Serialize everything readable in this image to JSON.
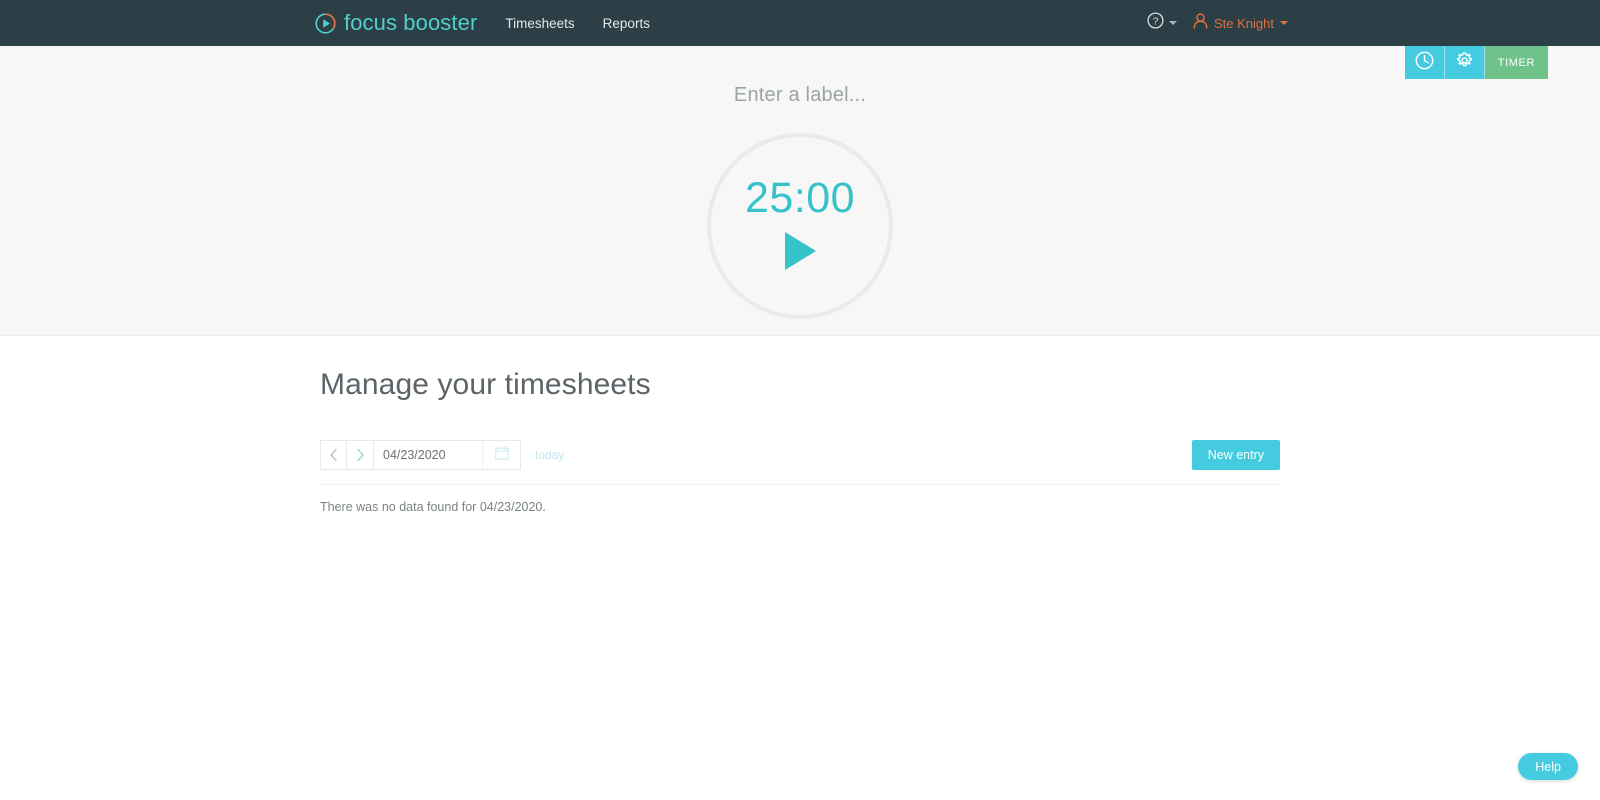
{
  "topbar": {
    "brand": {
      "name": "focus booster",
      "icon": "play-circle-icon"
    },
    "nav": [
      {
        "label": "Timesheets",
        "name": "nav-link-timesheets"
      },
      {
        "label": "Reports",
        "name": "nav-link-reports"
      }
    ],
    "help": {
      "icon": "question-circle-icon"
    },
    "user": {
      "name": "Ste Knight",
      "icon": "user-avatar-icon"
    }
  },
  "timer_controls": {
    "history_icon": "clock-icon",
    "settings_icon": "gear-icon",
    "timer_label": "TIMER"
  },
  "timer": {
    "label_placeholder": "Enter a label...",
    "label_value": "",
    "time": "25:00",
    "play_icon": "play-icon"
  },
  "main": {
    "title": "Manage your timesheets",
    "toolbar": {
      "prev_icon": "chevron-left-icon",
      "next_icon": "chevron-right-icon",
      "date_value": "04/23/2020",
      "date_placeholder": "mm/dd/yyyy",
      "calendar_icon": "calendar-icon",
      "today_label": "today",
      "new_entry_label": "New entry"
    },
    "empty_message": "There was no data found for 04/23/2020."
  },
  "help_widget": {
    "label": "Help"
  },
  "colors": {
    "header_bg": "#2c3e46",
    "accent_green": "#6fc38a",
    "accent_teal": "#45cbe0",
    "timer_teal": "#35c2c9",
    "brand_teal": "#4fd0cd",
    "user_orange": "#e2703a",
    "panel_bg": "#f7f7f7"
  }
}
